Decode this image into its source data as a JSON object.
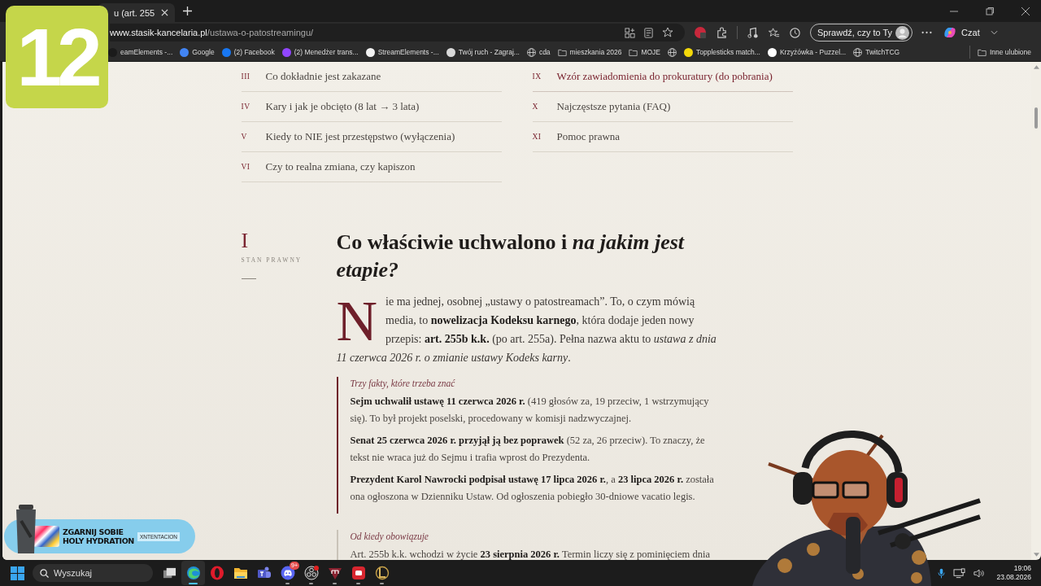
{
  "overlay_badge": {
    "text": "12"
  },
  "browser": {
    "tab": {
      "title": "u (art. 255",
      "selected": true
    },
    "address": {
      "domain": "www.stasik-kancelaria.pl",
      "path": "/ustawa-o-patostreamingu/"
    },
    "profile_button": "Sprawdź, czy to Ty",
    "chat_button": "Czat",
    "bookmarks": [
      {
        "kind": "site",
        "label": "eamElements -...",
        "color": "#1b1b1b"
      },
      {
        "kind": "site",
        "label": "Google",
        "color": "#4285f4"
      },
      {
        "kind": "site",
        "label": "(2) Facebook",
        "color": "#1877f2"
      },
      {
        "kind": "site",
        "label": "(2) Menedżer trans...",
        "color": "#9146ff"
      },
      {
        "kind": "site",
        "label": "StreamElements -...",
        "color": "#f2f2f2"
      },
      {
        "kind": "site",
        "label": "Twój ruch - Zagraj...",
        "color": "#d9d9d9"
      },
      {
        "kind": "globe",
        "label": "cda"
      },
      {
        "kind": "folder",
        "label": "mieszkania 2026"
      },
      {
        "kind": "folder",
        "label": "MOJE"
      },
      {
        "kind": "globe"
      },
      {
        "kind": "site",
        "label": "Topplesticks match...",
        "color": "#f5d90a"
      },
      {
        "kind": "site",
        "label": "Krzyżówka - Puzzel...",
        "color": "#ffffff"
      },
      {
        "kind": "globe",
        "label": "TwitchTCG"
      }
    ],
    "other_bookmarks": "Inne ulubione"
  },
  "toc": {
    "left": [
      {
        "numeral": "III",
        "title": "Co dokładnie jest zakazane",
        "selected": false
      },
      {
        "numeral": "IV",
        "title": "Kary i jak je obcięto (8 lat → 3 lata)",
        "selected": false
      },
      {
        "numeral": "V",
        "title": "Kiedy to NIE jest przestępstwo (wyłączenia)",
        "selected": false
      },
      {
        "numeral": "VI",
        "title": "Czy to realna zmiana, czy kapiszon",
        "selected": false
      }
    ],
    "right": [
      {
        "numeral": "IX",
        "title": "Wzór zawiadomienia do prokuratury (do pobrania)",
        "selected": true
      },
      {
        "numeral": "X",
        "title": "Najczęstsze pytania (FAQ)",
        "selected": false
      },
      {
        "numeral": "XI",
        "title": "Pomoc prawna",
        "selected": false
      }
    ]
  },
  "section": {
    "numeral": "I",
    "label": "STAN PRAWNY",
    "heading": "Co właściwie uchwalono i *na jakim jest etapie?*",
    "lead": "Nie ma jednej, osobnej „ustawy o patostreamach”. To, o czym mówią media, to **nowelizacja Kodeksu karnego**, która dodaje jeden nowy przepis: **art. 255b k.k.** (po art. 255a). Pełna nazwa aktu to *ustawa z dnia 11 czerwca 2026 r. o zmianie ustawy Kodeks karny*.",
    "boxes": [
      {
        "kind": "accent",
        "title": "Trzy fakty, które trzeba znać",
        "paragraphs": [
          "**Sejm uchwalił ustawę 11 czerwca 2026 r.** (419 głosów za, 19 przeciw, 1 wstrzymujący się). To był projekt poselski, procedowany w komisji nadzwyczajnej.",
          "**Senat 25 czerwca 2026 r. przyjął ją bez poprawek** (52 za, 26 przeciw). To znaczy, że tekst nie wraca już do Sejmu i trafia wprost do Prezydenta.",
          "**Prezydent Karol Nawrocki podpisał ustawę 17 lipca 2026 r.**, a **23 lipca 2026 r.** została ona ogłoszona w Dzienniku Ustaw. Od ogłoszenia pobiegło 30-dniowe vacatio legis."
        ]
      },
      {
        "kind": "plain",
        "title": "Od kiedy obowiązuje",
        "paragraphs": [
          "Art. 255b k.k. wchodzi w życie **23 sierpnia 2026 r.** Termin liczy się z pominięciem dnia"
        ]
      }
    ]
  },
  "ad": {
    "headline": [
      "ZGARNIJ SOBIE",
      "HOLY HYDRATION"
    ],
    "code": "XNTENTACION"
  },
  "taskbar": {
    "search_placeholder": "Wyszukaj",
    "apps": [
      {
        "kind": "taskview",
        "selected": false,
        "running": false
      },
      {
        "kind": "edge",
        "selected": true,
        "running": true
      },
      {
        "kind": "opera",
        "selected": false,
        "running": false
      },
      {
        "kind": "explorer",
        "selected": false,
        "running": false
      },
      {
        "kind": "teams",
        "selected": false,
        "running": false
      },
      {
        "kind": "discord",
        "selected": false,
        "running": true,
        "badge": "9+"
      },
      {
        "kind": "obs",
        "selected": false,
        "running": true
      },
      {
        "kind": "shield",
        "selected": false,
        "running": true
      },
      {
        "kind": "redapp",
        "selected": false,
        "running": true
      },
      {
        "kind": "league",
        "selected": false,
        "running": true
      }
    ],
    "time": "19:06",
    "date": "23.08.2026"
  }
}
